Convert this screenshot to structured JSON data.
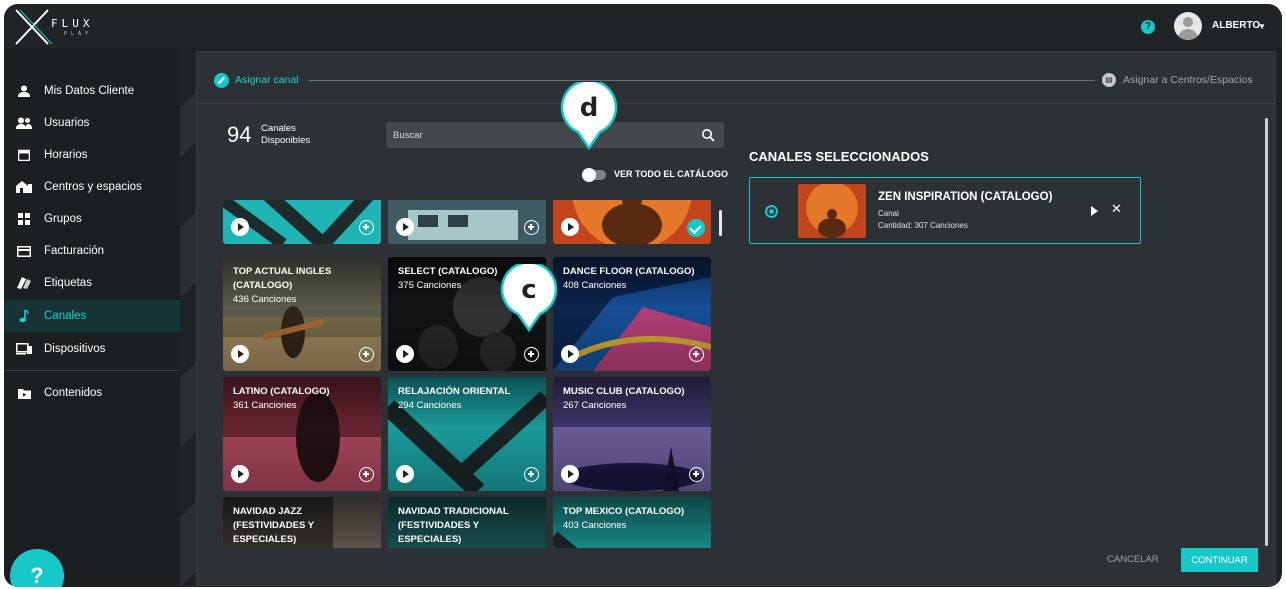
{
  "app": {
    "logo_text": "FLUX",
    "logo_subtext": "PLAY",
    "help_top_glyph": "?",
    "user_name": "ALBERTO",
    "help_bottom_glyph": "?"
  },
  "sidebar": {
    "items": [
      {
        "label": "Mis Datos Cliente",
        "icon": "user-icon"
      },
      {
        "label": "Usuarios",
        "icon": "users-icon"
      },
      {
        "label": "Horarios",
        "icon": "calendar-icon"
      },
      {
        "label": "Centros y espacios",
        "icon": "building-icon"
      },
      {
        "label": "Grupos",
        "icon": "grid-icon"
      },
      {
        "label": "Facturación",
        "icon": "card-icon"
      },
      {
        "label": "Etiquetas",
        "icon": "tag-icon"
      },
      {
        "label": "Canales",
        "icon": "music-note-icon",
        "active": true
      },
      {
        "label": "Dispositivos",
        "icon": "devices-icon"
      },
      {
        "label": "Contenidos",
        "icon": "folder-icon"
      }
    ]
  },
  "stepper": {
    "step1_label": "Asignar canal",
    "step2_label": "Asignar a Centros/Espacios"
  },
  "catalog": {
    "count": "94",
    "count_label_1": "Canales",
    "count_label_2": "Disponibles",
    "search_placeholder": "Buscar",
    "toggle_label": "VER TODO EL CATÁLOGO",
    "toggle_on": false
  },
  "channels": [
    {
      "title": "",
      "songs": "",
      "selected": false
    },
    {
      "title": "",
      "songs": "",
      "selected": false
    },
    {
      "title": "",
      "songs": "",
      "selected": true
    },
    {
      "title": "TOP ACTUAL INGLES (CATALOGO)",
      "songs": "436 Canciones",
      "selected": false
    },
    {
      "title": "SELECT (CATALOGO)",
      "songs": "375 Canciones",
      "selected": false
    },
    {
      "title": "DANCE FLOOR (CATALOGO)",
      "songs": "408 Canciones",
      "selected": false
    },
    {
      "title": "LATINO (CATALOGO)",
      "songs": "361 Canciones",
      "selected": false
    },
    {
      "title": "RELAJACIÓN ORIENTAL",
      "songs": "294 Canciones",
      "selected": false
    },
    {
      "title": "MUSIC CLUB (CATALOGO)",
      "songs": "267 Canciones",
      "selected": false
    },
    {
      "title": "NAVIDAD JAZZ (FESTIVIDADES Y ESPECIALES)",
      "songs": "",
      "selected": false
    },
    {
      "title": "NAVIDAD TRADICIONAL (FESTIVIDADES Y ESPECIALES)",
      "songs": "",
      "selected": false
    },
    {
      "title": "TOP MEXICO (CATALOGO)",
      "songs": "403 Canciones",
      "selected": false
    }
  ],
  "selected": {
    "heading": "CANALES SELECCIONADOS",
    "name": "ZEN INSPIRATION (CATALOGO)",
    "type": "Canal",
    "quantity": "Cantidad: 307 Canciones"
  },
  "actions": {
    "cancel_label": "CANCELAR",
    "continue_label": "CONTINUAR"
  },
  "callouts": {
    "d": "d",
    "c": "c"
  },
  "colors": {
    "accent": "#16c8c8",
    "panel": "#2c3135",
    "sidebar": "#1b1f22"
  }
}
